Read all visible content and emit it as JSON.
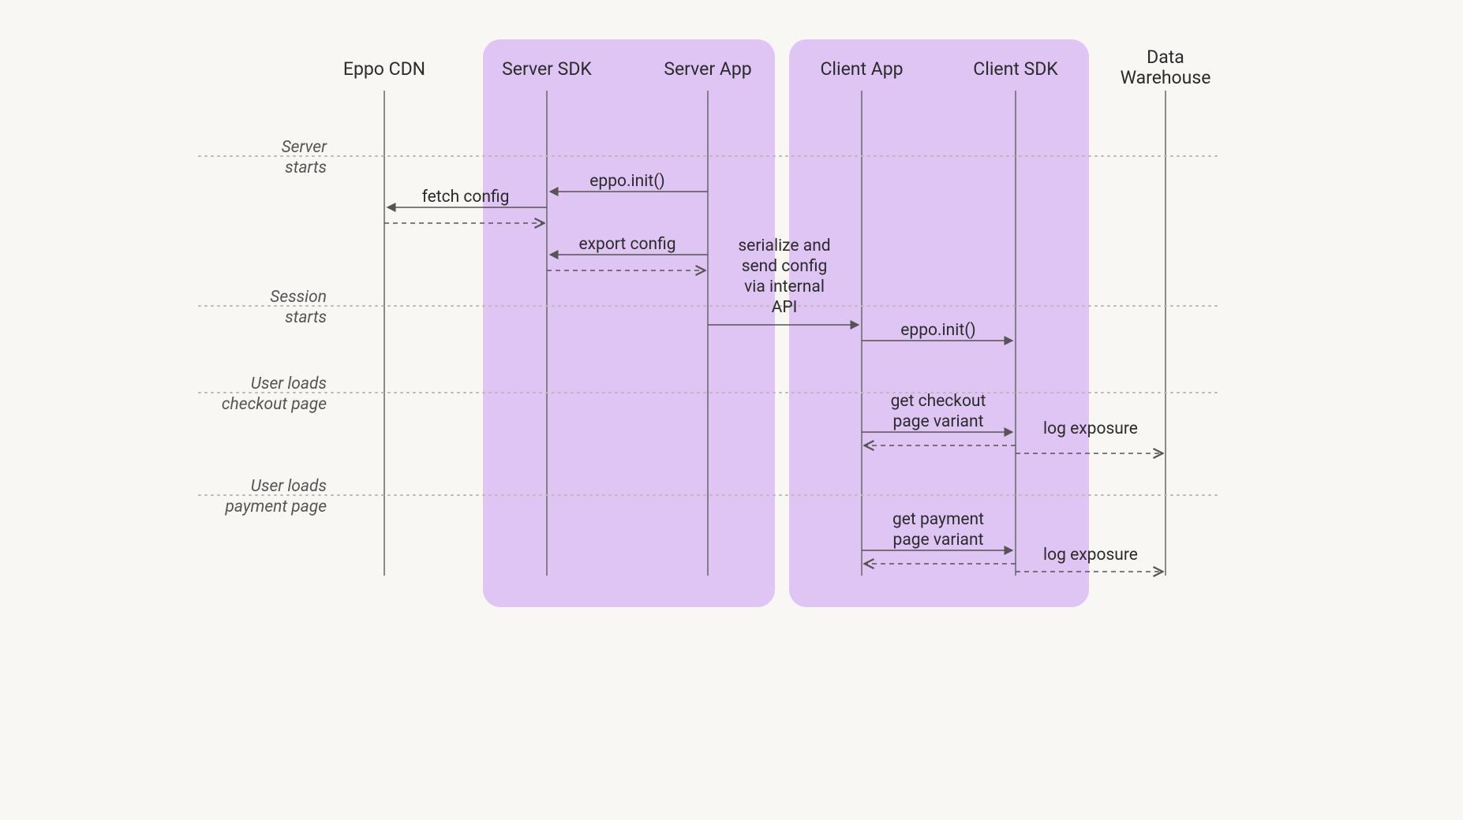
{
  "participants": {
    "eppo_cdn": "Eppo CDN",
    "server_sdk": "Server SDK",
    "server_app": "Server App",
    "client_app": "Client App",
    "client_sdk": "Client SDK",
    "data_warehouse_l1": "Data",
    "data_warehouse_l2": "Warehouse"
  },
  "phases": {
    "server_starts_l1": "Server",
    "server_starts_l2": "starts",
    "session_starts_l1": "Session",
    "session_starts_l2": "starts",
    "user_checkout_l1": "User loads",
    "user_checkout_l2": "checkout page",
    "user_payment_l1": "User loads",
    "user_payment_l2": "payment page"
  },
  "messages": {
    "eppo_init_server": "eppo.init()",
    "fetch_config": "fetch config",
    "export_config": "export config",
    "serialize_send_l1": "serialize and",
    "serialize_send_l2": "send config",
    "serialize_send_l3": "via internal",
    "serialize_send_l4": "API",
    "eppo_init_client": "eppo.init()",
    "get_checkout_l1": "get checkout",
    "get_checkout_l2": "page variant",
    "log_exposure_1": "log exposure",
    "get_payment_l1": "get payment",
    "get_payment_l2": "page variant",
    "log_exposure_2": "log exposure"
  }
}
